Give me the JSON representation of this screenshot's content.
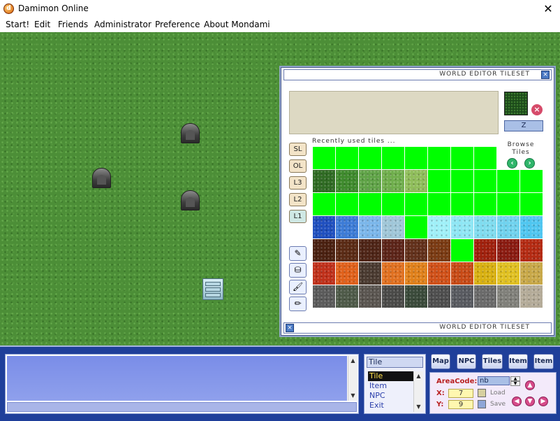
{
  "window": {
    "title": "Damimon Online",
    "icon": "damimon-app-icon",
    "close_glyph": "✕"
  },
  "menu": [
    "Start!",
    "Edit",
    "Friends",
    "Administrator",
    "Preference",
    "About Mondami"
  ],
  "tileset": {
    "title": "WORLD EDITOR TILESET",
    "corner_icon": "x-box-icon",
    "layer_value": "Z",
    "recent_label": "Recently used tiles ...",
    "browse_label": "Browse Tiles",
    "layers": [
      "SL",
      "OL",
      "L3",
      "L2",
      "L1"
    ],
    "active_layer": "L1",
    "tools": [
      "eraser-icon",
      "fill-bucket-icon",
      "brush-icon",
      "pencil-icon"
    ],
    "tile_rows": [
      [
        "#00ff00",
        "#00ff00",
        "#00ff00",
        "#00ff00",
        "#00ff00",
        "#00ff00",
        "#00ff00",
        "#00ff00"
      ],
      [
        "#2f6b23",
        "#3e8a2c",
        "#5fa347",
        "#6fae4c",
        "#8fbd5a",
        "#00ff00",
        "#00ff00",
        "#00ff00",
        "#00ff00",
        "#00ff00"
      ],
      [
        "#00ff00",
        "#00ff00",
        "#00ff00",
        "#00ff00",
        "#00ff00",
        "#00ff00",
        "#00ff00",
        "#00ff00",
        "#00ff00",
        "#00ff00"
      ],
      [
        "#1f4fbf",
        "#3c7bd6",
        "#7ab6ea",
        "#9fc6d8",
        "#00ff00",
        "#9ff0f8",
        "#8ee6f4",
        "#7fdcef",
        "#6fd2ee",
        "#4fc6f0"
      ],
      [
        "#4a2010",
        "#5a2a14",
        "#4e2416",
        "#5c2418",
        "#62301a",
        "#7a3a12",
        "#00ff00",
        "#a0200c",
        "#8a1a10",
        "#b42a12"
      ],
      [
        "#c0301a",
        "#e0601a",
        "#4a3a30",
        "#e07020",
        "#e0801a",
        "#d05018",
        "#c84a16",
        "#d8b010",
        "#e0c020",
        "#c8a848"
      ],
      [
        "#5a5a5a",
        "#4e5a48",
        "#5a5550",
        "#4a4a48",
        "#3a4a3a",
        "#4e4e4e",
        "#585a60",
        "#6a6a6a",
        "#80807a",
        "#b4ab98"
      ]
    ]
  },
  "bottom": {
    "mode_header": "Tile",
    "modes": [
      "Tile",
      "Item",
      "NPC",
      "Exit"
    ],
    "selected_mode": "Tile",
    "nav_buttons": [
      "Map",
      "NPC",
      "Tiles",
      "Item",
      "Item"
    ],
    "area": {
      "areacode_label": "AreaCode:",
      "areacode_value": "nb",
      "x_label": "X:",
      "x_value": "7",
      "y_label": "Y:",
      "y_value": "9",
      "load_label": "Load",
      "save_label": "Save"
    }
  }
}
